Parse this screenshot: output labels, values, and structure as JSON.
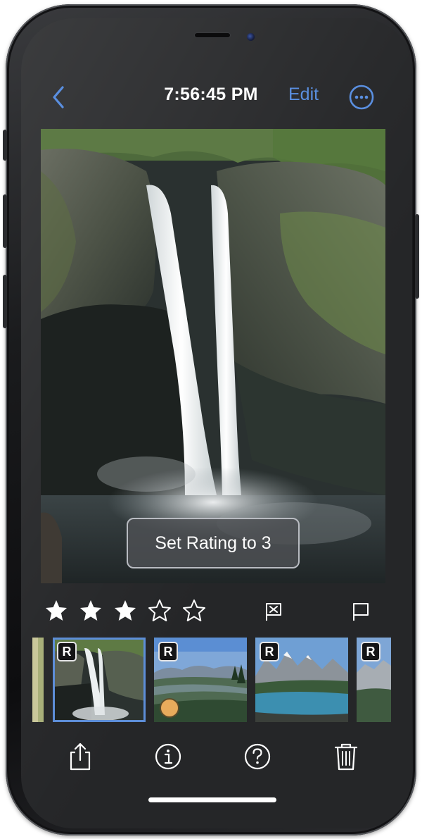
{
  "status": {
    "time": "7:56:45 PM"
  },
  "nav": {
    "edit_label": "Edit",
    "back_icon": "chevron-left-icon",
    "more_icon": "ellipsis-circle-icon"
  },
  "toast": {
    "text": "Set Rating to 3"
  },
  "rating": {
    "value": 3,
    "max": 5
  },
  "filmstrip": {
    "badge_label": "R",
    "items": [
      {
        "name": "partial-previous",
        "badge": false,
        "selected": false
      },
      {
        "name": "waterfall",
        "badge": true,
        "selected": true
      },
      {
        "name": "mountain-valley",
        "badge": true,
        "selected": false,
        "color_label": "#e8ab5c"
      },
      {
        "name": "mountain-lake",
        "badge": true,
        "selected": false
      },
      {
        "name": "mountain-peaks",
        "badge": true,
        "selected": false
      }
    ]
  },
  "toolbar": {
    "icons": [
      "share-icon",
      "info-icon",
      "help-icon",
      "trash-icon"
    ]
  },
  "colors": {
    "accent": "#5a8fe0",
    "selection": "#5d8ed8",
    "background": "#252628"
  }
}
